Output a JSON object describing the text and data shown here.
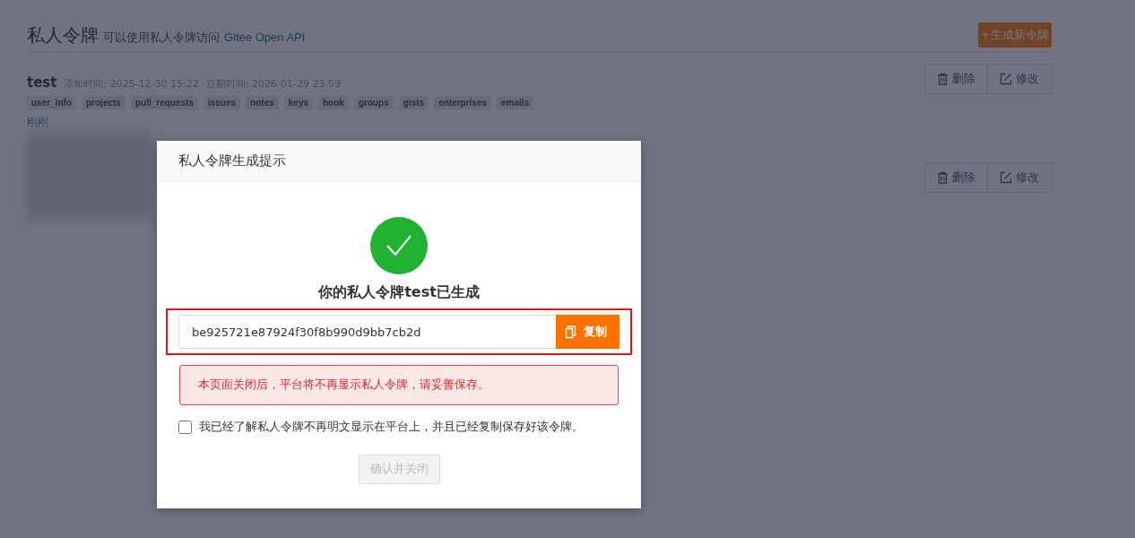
{
  "page": {
    "title": "私人令牌",
    "subtitle": "可以使用私人令牌访问",
    "subtitle_link": "Gitee Open API",
    "generate_button": "+生成新令牌"
  },
  "tokens": [
    {
      "kind": "visible",
      "name": "test",
      "added": "添加时间: 2025-12-30 15:22",
      "expires": "过期时间: 2026-01-29 23:59",
      "scopes": [
        "user_info",
        "projects",
        "pull_requests",
        "issues",
        "notes",
        "keys",
        "hook",
        "groups",
        "gists",
        "enterprises",
        "emails"
      ],
      "last_used": "刚刚",
      "delete": "删除",
      "edit": "修改"
    },
    {
      "kind": "redacted",
      "delete": "删除",
      "edit": "修改"
    }
  ],
  "modal": {
    "title": "私人令牌生成提示",
    "heading": "你的私人令牌test已生成",
    "token_value": "be925721e87924f30f8b990d9bb7cb2d",
    "copy_button": "复制",
    "warning": "本页面关闭后，平台将不再显示私人令牌，请妥善保存。",
    "acknowledge": {
      "label": "我已经了解私人令牌不再明文显示在平台上，并且已经复制保存好该令牌。",
      "checked": false
    },
    "confirm": {
      "label": "确认并关闭",
      "disabled": true
    }
  }
}
